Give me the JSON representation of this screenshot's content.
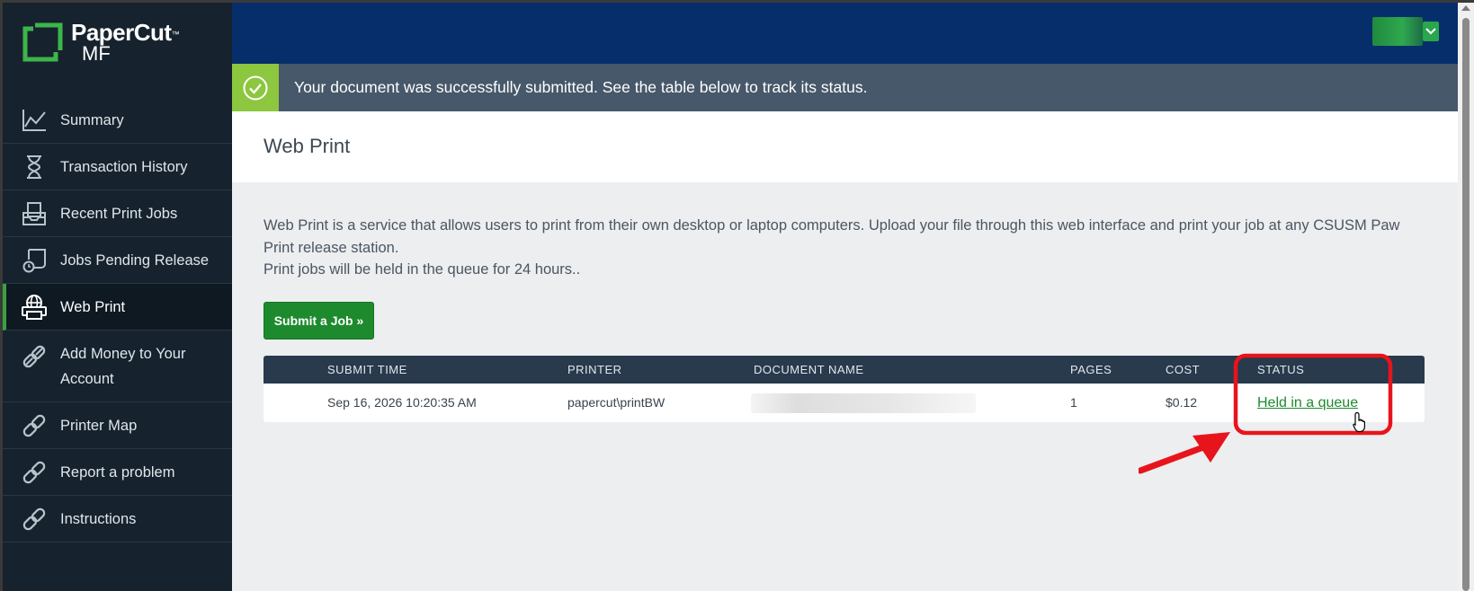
{
  "app": {
    "logo_line1": "PaperCut",
    "logo_tm": "™",
    "logo_line2": "MF"
  },
  "sidebar": {
    "items": [
      {
        "label": "Summary",
        "icon": "chart-line-icon"
      },
      {
        "label": "Transaction History",
        "icon": "hourglass-icon"
      },
      {
        "label": "Recent Print Jobs",
        "icon": "inbox-icon"
      },
      {
        "label": "Jobs Pending Release",
        "icon": "document-clock-icon"
      },
      {
        "label": "Web Print",
        "icon": "web-printer-icon",
        "active": true
      },
      {
        "label": "Add Money to Your Account",
        "icon": "link-icon"
      },
      {
        "label": "Printer Map",
        "icon": "link-icon"
      },
      {
        "label": "Report a problem",
        "icon": "link-icon"
      },
      {
        "label": "Instructions",
        "icon": "link-icon"
      }
    ]
  },
  "banner": {
    "message": "Your document was successfully submitted. See the table below to track its status.",
    "icon": "check-circle-icon"
  },
  "page": {
    "title": "Web Print",
    "description_line1": "Web Print is a service that allows users to print from their own desktop or laptop computers. Upload your file through this web interface and print your job at any CSUSM Paw Print release station.",
    "description_line2": "Print jobs will be held in the queue for 24 hours..",
    "submit_label": "Submit a Job »"
  },
  "table": {
    "headers": {
      "submit_time": "SUBMIT TIME",
      "printer": "PRINTER",
      "document_name": "DOCUMENT NAME",
      "pages": "PAGES",
      "cost": "COST",
      "status": "STATUS"
    },
    "rows": [
      {
        "submit_time": "Sep 16, 2026 10:20:35 AM",
        "printer": "papercut\\printBW",
        "document_name": "",
        "pages": "1",
        "cost": "$0.12",
        "status": "Held in a queue"
      }
    ]
  },
  "colors": {
    "sidebar_bg": "#16222d",
    "topbar_bg": "#062e6b",
    "banner_bg": "#47586a",
    "success_accent": "#8dc63f",
    "primary_green": "#1e8a2e",
    "annotation_red": "#e8141b"
  }
}
